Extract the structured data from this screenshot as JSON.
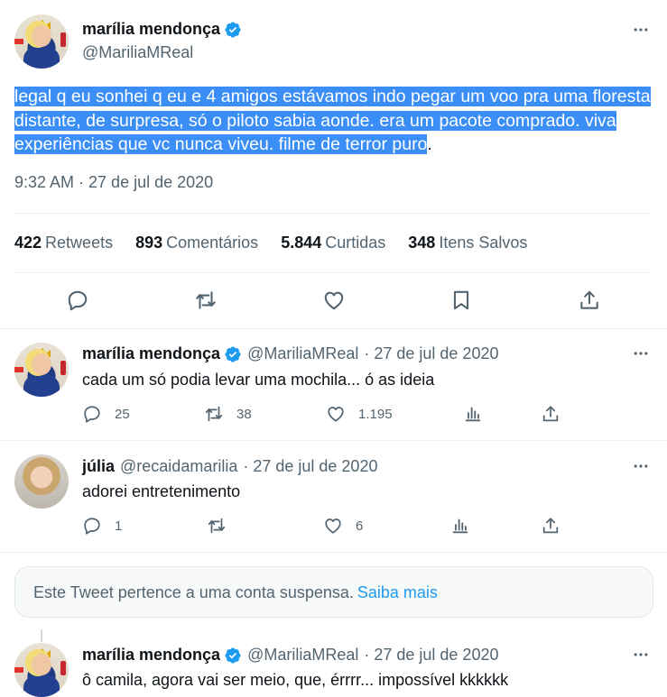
{
  "main_tweet": {
    "display_name": "marília mendonça",
    "handle": "@MariliaMReal",
    "text": "legal q eu sonhei q eu e 4 amigos estávamos indo pegar um voo pra uma floresta distante, de surpresa, só o piloto sabia aonde. era um pacote comprado. viva experiências que vc nunca viveu. filme de terror puro",
    "text_end": ".",
    "timestamp": "9:32 AM · 27 de jul de 2020",
    "stats": [
      {
        "value": "422",
        "label": "Retweets"
      },
      {
        "value": "893",
        "label": "Comentários"
      },
      {
        "value": "5.844",
        "label": "Curtidas"
      },
      {
        "value": "348",
        "label": "Itens Salvos"
      }
    ]
  },
  "replies": [
    {
      "display_name": "marília mendonça",
      "handle": "@MariliaMReal",
      "date": "· 27 de jul de 2020",
      "text": "cada um só podia levar uma mochila... ó as ideia",
      "replies": "25",
      "retweets": "38",
      "likes": "1.195"
    },
    {
      "display_name": "júlia",
      "handle": "@recaidamarilia",
      "date": "· 27 de jul de 2020",
      "text": "adorei entretenimento",
      "replies": "1",
      "retweets": "",
      "likes": "6"
    }
  ],
  "suspended_notice": {
    "text": "Este Tweet pertence a uma conta suspensa.",
    "link": "Saiba mais"
  },
  "last_reply": {
    "display_name": "marília mendonça",
    "handle": "@MariliaMReal",
    "date": "· 27 de jul de 2020",
    "text": "ô camila, agora vai ser meio, que, érrrr... impossível kkkkkk"
  },
  "colors": {
    "accent": "#1d9bf0",
    "selection": "#3a8ef6",
    "secondary_text": "#536471",
    "divider": "#eff3f4"
  },
  "icons": [
    "verified-badge-icon",
    "more-icon",
    "reply-icon",
    "retweet-icon",
    "like-icon",
    "bookmark-icon",
    "share-icon",
    "views-icon"
  ]
}
